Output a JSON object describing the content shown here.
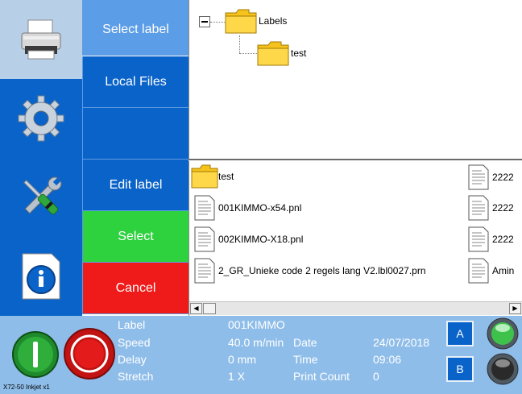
{
  "menu": {
    "select_label": "Select label",
    "local_files": "Local Files",
    "blank": "",
    "edit_label": "Edit label",
    "select": "Select",
    "cancel": "Cancel"
  },
  "sidebar_icons": [
    "printer-icon",
    "gear-icon",
    "tools-icon",
    "info-icon"
  ],
  "tree": {
    "root": "Labels",
    "child": "test"
  },
  "files": {
    "col1": [
      "test",
      "001KIMMO-x54.pnl",
      "002KIMMO-X18.pnl",
      "2_GR_Unieke code 2 regels lang V2.lbl0027.prn"
    ],
    "col2": [
      "2222",
      "2222",
      "2222",
      "Amin"
    ]
  },
  "status": {
    "label_key": "Label",
    "label_val": "001KIMMO",
    "speed_key": "Speed",
    "speed_val": "40.0 m/min",
    "date_key": "Date",
    "date_val": "24/07/2018",
    "delay_key": "Delay",
    "delay_val": "0 mm",
    "time_key": "Time",
    "time_val": "09:06",
    "stretch_key": "Stretch",
    "stretch_val": "1 X",
    "count_key": "Print Count",
    "count_val": "0",
    "btn_a": "A",
    "btn_b": "B",
    "model": "X72-50 Inkjet x1"
  },
  "colors": {
    "blue": "#0a63c9",
    "green": "#2ed13e",
    "red": "#ef1a1a",
    "status_bg": "#8fbde9"
  }
}
